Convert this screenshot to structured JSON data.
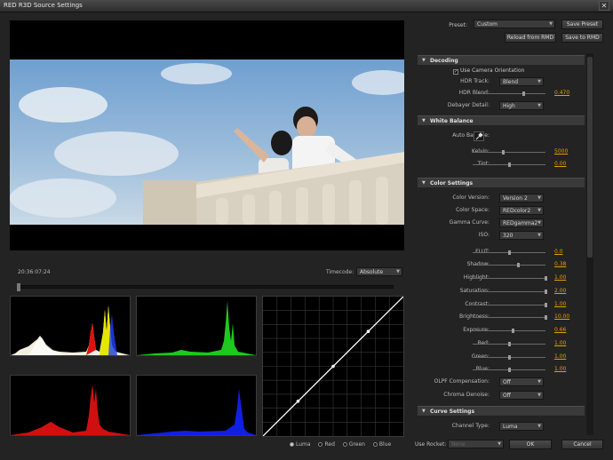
{
  "window": {
    "title": "RED R3D Source Settings",
    "close_glyph": "✕"
  },
  "viewer": {
    "timecode": "20:36:07:24",
    "timecode_label": "Timecode:",
    "timecode_mode": "Absolute"
  },
  "curve_channels": {
    "options": [
      "Luma",
      "Red",
      "Green",
      "Blue"
    ],
    "selected": "Luma"
  },
  "preset": {
    "label": "Preset:",
    "value": "Custom",
    "save_preset": "Save Preset",
    "reload_rmd": "Reload from RMD",
    "save_rmd": "Save to RMD"
  },
  "decoding": {
    "header": "Decoding",
    "use_camera_orientation": "Use Camera Orientation",
    "hdr_track_label": "HDR Track:",
    "hdr_track": "Blend",
    "hdr_blend_label": "HDR Blend:",
    "hdr_blend": "0.470",
    "debayer_label": "Debayer Detail:",
    "debayer": "High"
  },
  "white_balance": {
    "header": "White Balance",
    "auto_balance_label": "Auto Balance:",
    "kelvin_label": "Kelvin:",
    "kelvin": "5000",
    "tint_label": "Tint:",
    "tint": "0.00"
  },
  "color_settings": {
    "header": "Color Settings",
    "color_version_label": "Color Version:",
    "color_version": "Version 2",
    "color_space_label": "Color Space:",
    "color_space": "REDcolor2",
    "gamma_curve_label": "Gamma Curve:",
    "gamma_curve": "REDgamma2",
    "iso_label": "ISO:",
    "iso": "320",
    "flut_label": "FLUT:",
    "flut": "0.0",
    "shadow_label": "Shadow:",
    "shadow": "0.38",
    "highlight_label": "Highlight:",
    "highlight": "1.00",
    "saturation_label": "Saturation:",
    "saturation": "2.00",
    "contrast_label": "Contrast:",
    "contrast": "1.00",
    "brightness_label": "Brightness:",
    "brightness": "10.00",
    "exposure_label": "Exposure:",
    "exposure": "0.66",
    "red_label": "Red:",
    "red": "1.00",
    "green_label": "Green:",
    "green": "1.00",
    "blue_label": "Blue:",
    "blue": "1.00",
    "olpf_label": "OLPF Compensation:",
    "olpf": "Off",
    "chroma_label": "Chroma Denoise:",
    "chroma": "Off"
  },
  "curve_settings": {
    "header": "Curve Settings",
    "channel_type_label": "Channel Type:",
    "channel_type": "Luma"
  },
  "footer": {
    "use_rocket_label": "Use Rocket:",
    "use_rocket": "None",
    "ok": "OK",
    "cancel": "Cancel"
  },
  "slider_levels": {
    "hdr_blend": 0.7,
    "kelvin": 0.42,
    "tint": 0.5,
    "flut": 0.5,
    "shadow": 0.62,
    "highlight": 1.0,
    "saturation": 1.0,
    "contrast": 1.0,
    "brightness": 1.0,
    "exposure": 0.55,
    "red": 0.5,
    "green": 0.5,
    "blue": 0.5
  }
}
